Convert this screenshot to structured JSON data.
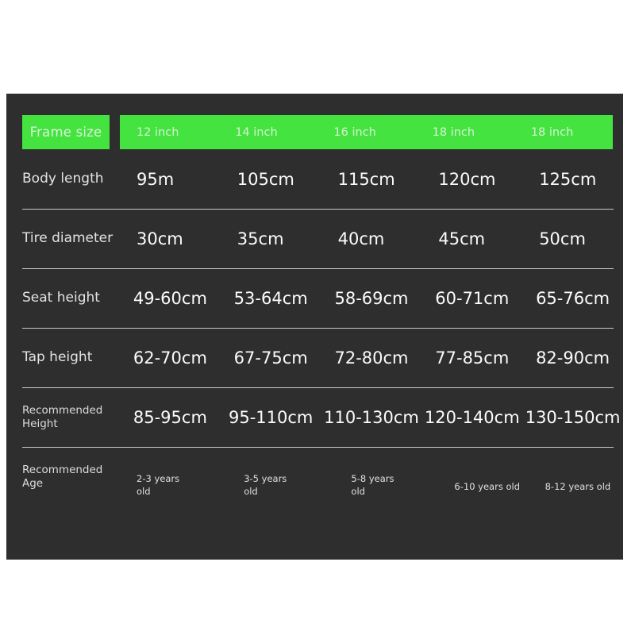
{
  "table": {
    "corner_label": "Frame size",
    "columns": [
      "12 inch",
      "14 inch",
      "16 inch",
      "18 inch",
      "18 inch"
    ],
    "rows": [
      {
        "label": "Body length",
        "values": [
          "95m",
          "105cm",
          "115cm",
          "120cm",
          "125cm"
        ]
      },
      {
        "label": "Tire diameter",
        "values": [
          "30cm",
          "35cm",
          "40cm",
          "45cm",
          "50cm"
        ]
      },
      {
        "label": "Seat height",
        "values": [
          "49-60cm",
          "53-64cm",
          "58-69cm",
          "60-71cm",
          "65-76cm"
        ]
      },
      {
        "label": "Tap height",
        "values": [
          "62-70cm",
          "67-75cm",
          "72-80cm",
          "77-85cm",
          "82-90cm"
        ]
      },
      {
        "label": "Recommended\nHeight",
        "values": [
          "85-95cm",
          "95-110cm",
          "110-130cm",
          "120-140cm",
          "130-150cm"
        ]
      },
      {
        "label": "Recommended\nAge",
        "values": [
          "2-3 years\nold",
          "3-5 years\nold",
          "5-8 years\nold",
          "6-10 years old",
          "8-12 years old"
        ]
      }
    ]
  },
  "colors": {
    "panel_background": "#2e2e2e",
    "page_background": "#ffffff",
    "header_green": "#44e340",
    "header_text": "#d6f3d3",
    "value_text": "#fbfbfb",
    "label_text": "#e3e3e3",
    "separator": "#c9c9c9"
  }
}
